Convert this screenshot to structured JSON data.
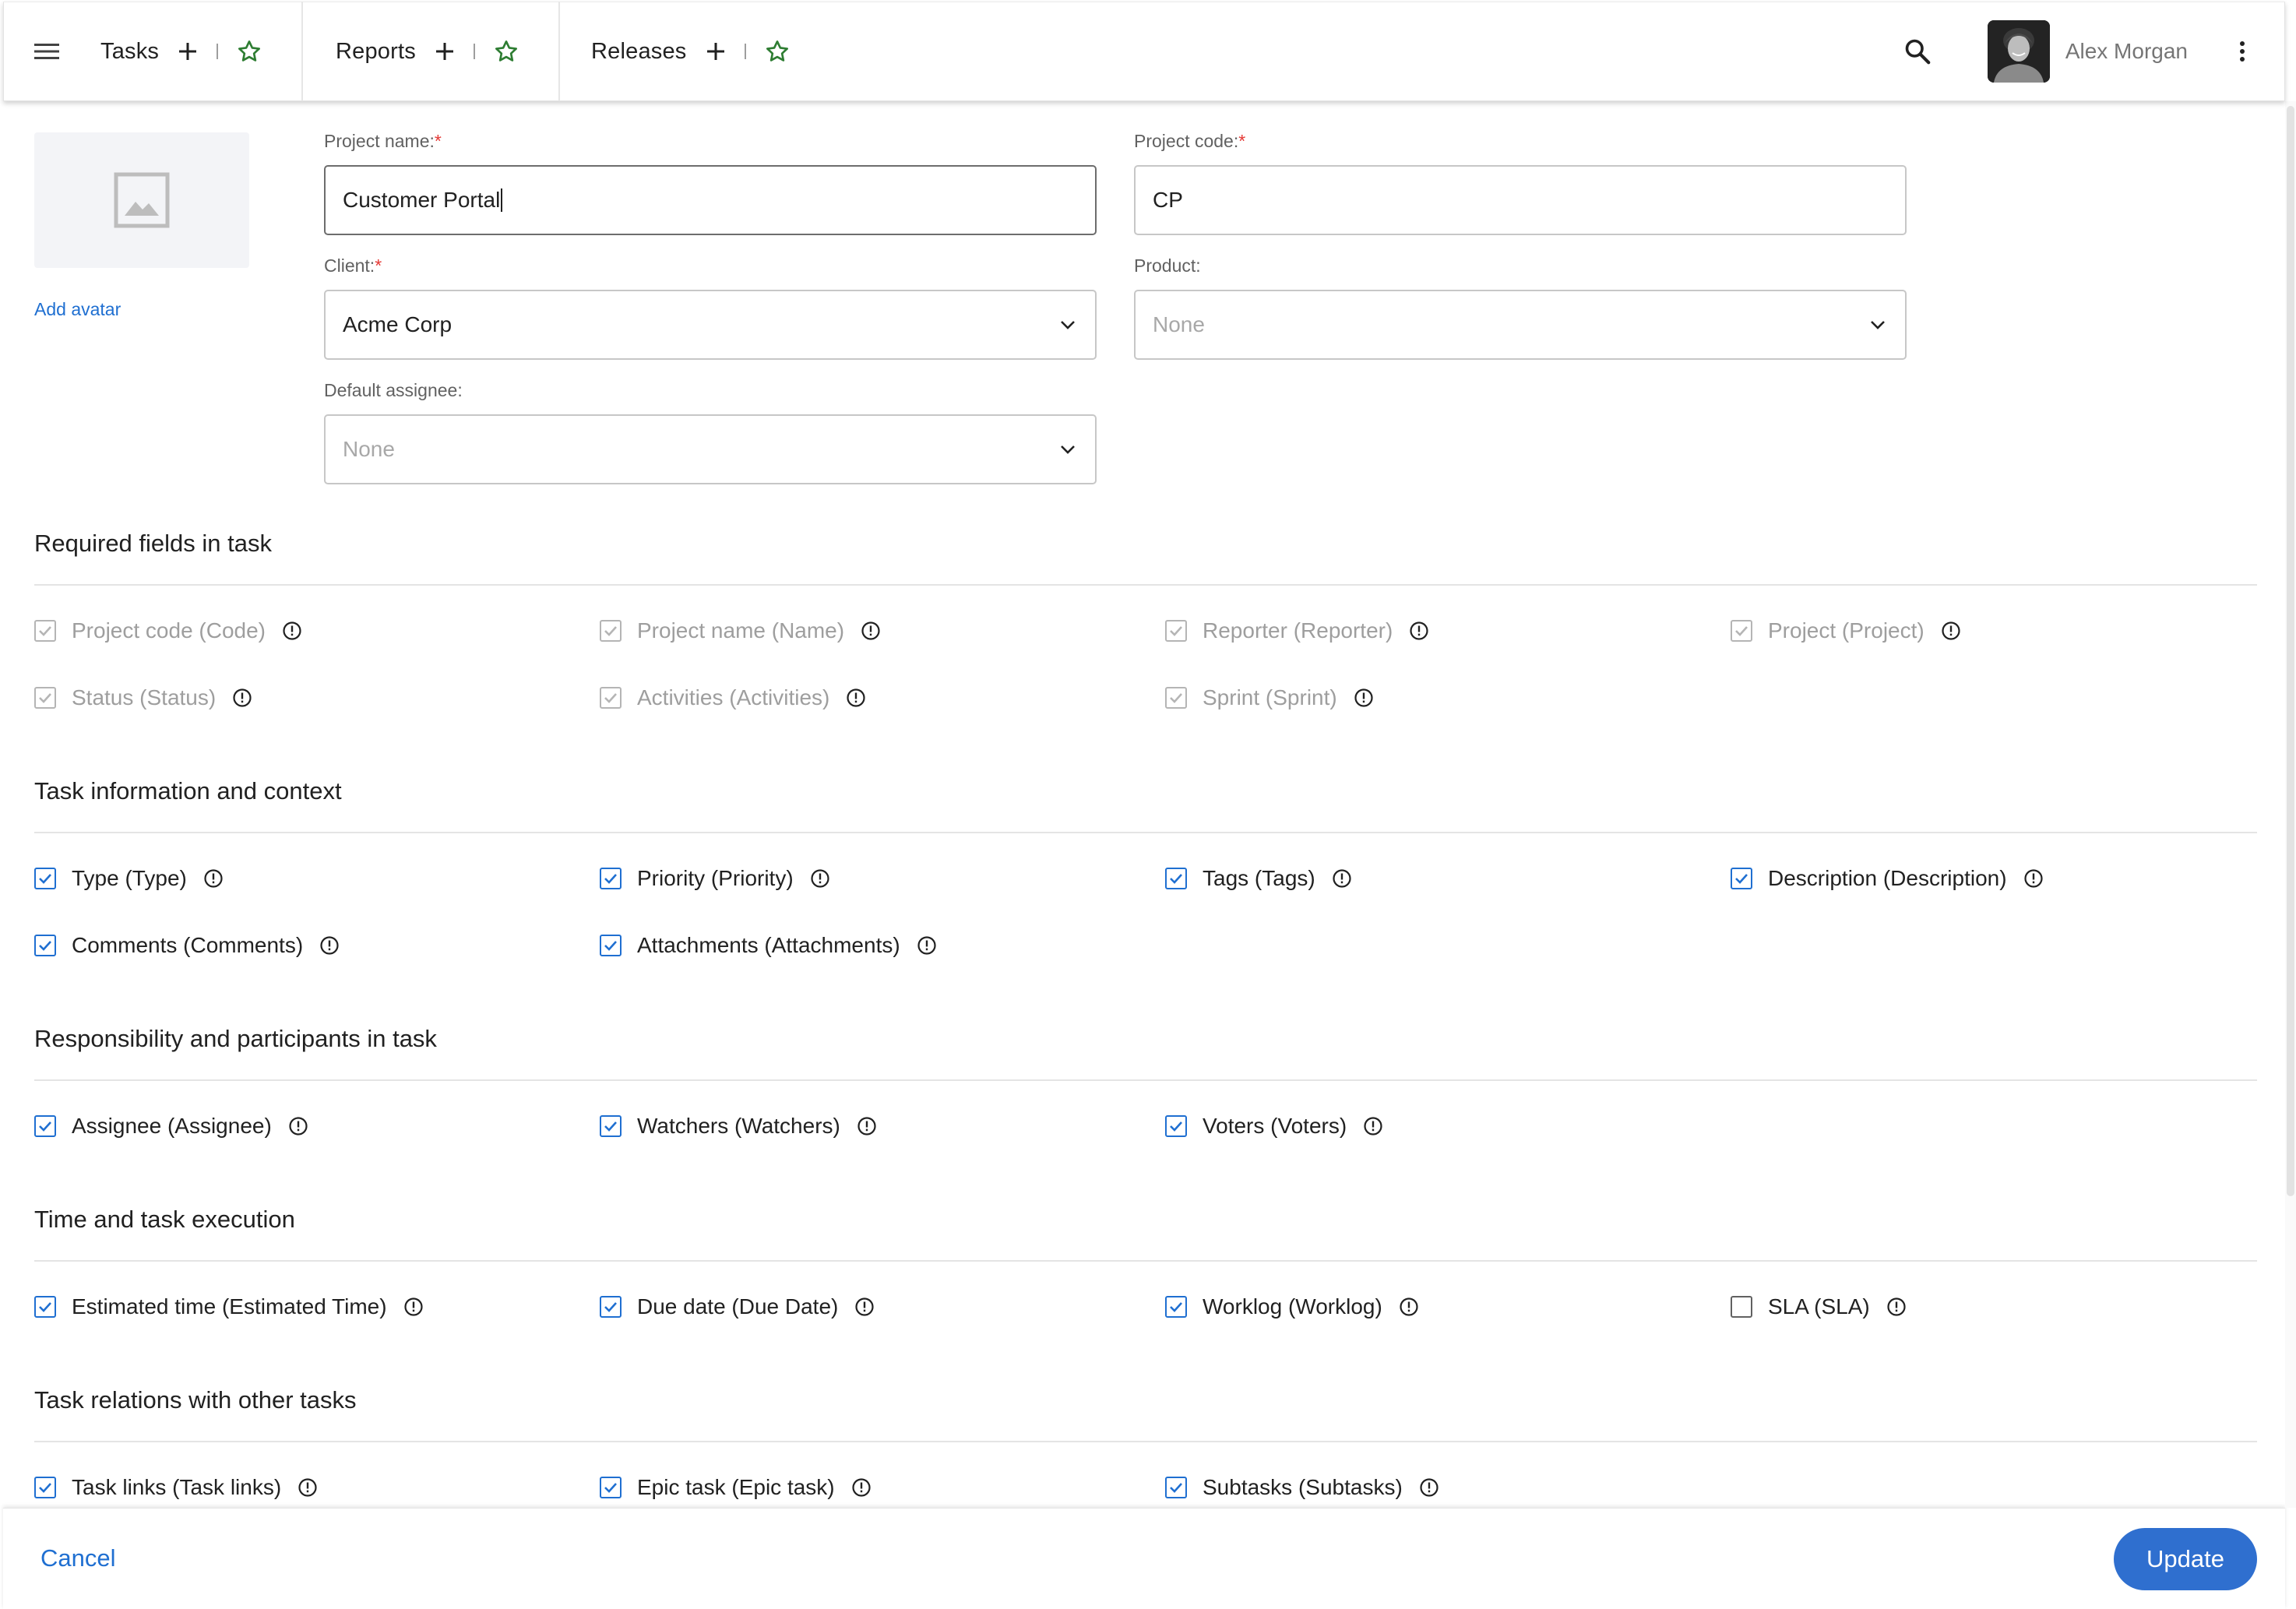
{
  "topbar": {
    "tabs": [
      {
        "label": "Tasks"
      },
      {
        "label": "Reports"
      },
      {
        "label": "Releases"
      }
    ],
    "user_name": "Alex Morgan"
  },
  "avatar": {
    "add_label": "Add avatar"
  },
  "form": {
    "project_name": {
      "label": "Project name:",
      "required_mark": "*",
      "value": "Customer Portal"
    },
    "project_code": {
      "label": "Project code:",
      "required_mark": "*",
      "value": "CP"
    },
    "client": {
      "label": "Client:",
      "required_mark": "*",
      "value": "Acme Corp"
    },
    "product": {
      "label": "Product:",
      "value": "None"
    },
    "default_assignee": {
      "label": "Default assignee:",
      "value": "None"
    }
  },
  "sections": [
    {
      "title": "Required fields in task",
      "items": [
        {
          "label": "Project code (Code)",
          "checked": true,
          "disabled": true
        },
        {
          "label": "Project name (Name)",
          "checked": true,
          "disabled": true
        },
        {
          "label": "Reporter (Reporter)",
          "checked": true,
          "disabled": true
        },
        {
          "label": "Project (Project)",
          "checked": true,
          "disabled": true
        },
        {
          "label": "Status (Status)",
          "checked": true,
          "disabled": true
        },
        {
          "label": "Activities (Activities)",
          "checked": true,
          "disabled": true
        },
        {
          "label": "Sprint (Sprint)",
          "checked": true,
          "disabled": true
        }
      ]
    },
    {
      "title": "Task information and context",
      "items": [
        {
          "label": "Type (Type)",
          "checked": true,
          "disabled": false
        },
        {
          "label": "Priority (Priority)",
          "checked": true,
          "disabled": false
        },
        {
          "label": "Tags (Tags)",
          "checked": true,
          "disabled": false
        },
        {
          "label": "Description (Description)",
          "checked": true,
          "disabled": false
        },
        {
          "label": "Comments (Comments)",
          "checked": true,
          "disabled": false
        },
        {
          "label": "Attachments (Attachments)",
          "checked": true,
          "disabled": false
        }
      ]
    },
    {
      "title": "Responsibility and participants in task",
      "items": [
        {
          "label": "Assignee (Assignee)",
          "checked": true,
          "disabled": false
        },
        {
          "label": "Watchers (Watchers)",
          "checked": true,
          "disabled": false
        },
        {
          "label": "Voters (Voters)",
          "checked": true,
          "disabled": false
        }
      ]
    },
    {
      "title": "Time and task execution",
      "items": [
        {
          "label": "Estimated time (Estimated Time)",
          "checked": true,
          "disabled": false
        },
        {
          "label": "Due date (Due Date)",
          "checked": true,
          "disabled": false
        },
        {
          "label": "Worklog (Worklog)",
          "checked": true,
          "disabled": false
        },
        {
          "label": "SLA (SLA)",
          "checked": false,
          "disabled": false
        }
      ]
    },
    {
      "title": "Task relations with other tasks",
      "items": [
        {
          "label": "Task links (Task links)",
          "checked": true,
          "disabled": false
        },
        {
          "label": "Epic task (Epic task)",
          "checked": true,
          "disabled": false
        },
        {
          "label": "Subtasks (Subtasks)",
          "checked": true,
          "disabled": false
        }
      ]
    }
  ],
  "footer": {
    "cancel_label": "Cancel",
    "update_label": "Update"
  },
  "colors": {
    "accent": "#1f6fd1",
    "primary_button": "#2f6fcf",
    "star": "#2e7d32",
    "required": "#e53935"
  }
}
